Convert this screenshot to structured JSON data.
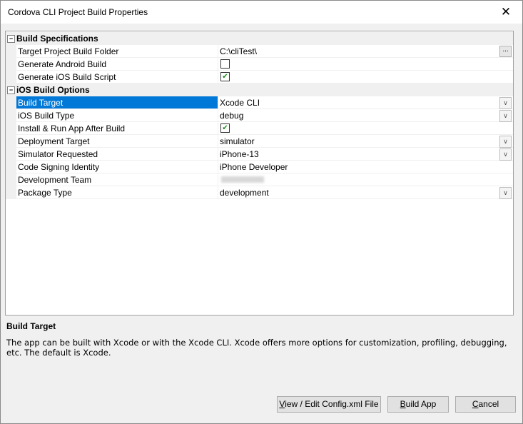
{
  "window": {
    "title": "Cordova CLI Project Build Properties",
    "close_glyph": "✕"
  },
  "grid": {
    "categories": [
      {
        "label": "Build Specifications",
        "expander": "−",
        "rows": [
          {
            "name": "Target Project Build Folder",
            "value": "C:\\cliTest\\",
            "editor": "ellipsis",
            "button": "..."
          },
          {
            "name": "Generate Android Build",
            "value": "",
            "editor": "checkbox",
            "checked": false
          },
          {
            "name": "Generate iOS Build Script",
            "value": "",
            "editor": "checkbox",
            "checked": true
          }
        ]
      },
      {
        "label": "iOS Build Options",
        "expander": "−",
        "rows": [
          {
            "name": "Build Target",
            "value": "Xcode CLI",
            "editor": "dropdown",
            "selected": true
          },
          {
            "name": "iOS Build Type",
            "value": "debug",
            "editor": "dropdown"
          },
          {
            "name": "Install & Run App After Build",
            "value": "",
            "editor": "checkbox",
            "checked": true
          },
          {
            "name": "Deployment Target",
            "value": "simulator",
            "editor": "dropdown"
          },
          {
            "name": "Simulator Requested",
            "value": "iPhone-13",
            "editor": "dropdown"
          },
          {
            "name": "Code Signing Identity",
            "value": "iPhone Developer",
            "editor": "text"
          },
          {
            "name": "Development Team",
            "value": "",
            "editor": "redacted"
          },
          {
            "name": "Package Type",
            "value": "development",
            "editor": "dropdown"
          }
        ]
      }
    ]
  },
  "description": {
    "title": "Build Target",
    "text": "The app can be built with Xcode or with the Xcode CLI. Xcode offers more options for customization, profiling, debugging, etc. The default is Xcode."
  },
  "buttons": {
    "view_edit_config": {
      "label": "View / Edit Config.xml File",
      "mnemonic": "V"
    },
    "build_app": {
      "label": "Build App",
      "mnemonic": "B"
    },
    "cancel": {
      "label": "Cancel",
      "mnemonic": "C"
    }
  },
  "icons": {
    "dropdown": "chevron-down-icon",
    "check": "checkmark-icon",
    "collapse": "minus-icon",
    "check_glyph": "✔",
    "dropdown_glyph": "∨"
  }
}
